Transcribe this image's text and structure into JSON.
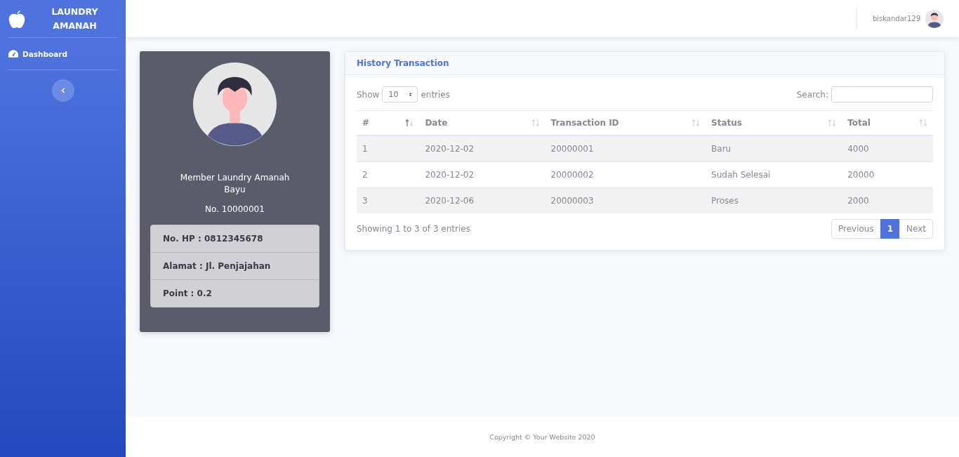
{
  "sidebar": {
    "brand": "LAUNDRY AMANAH",
    "items": [
      {
        "label": "Dashboard",
        "selected": true
      }
    ]
  },
  "topbar": {
    "username": "biskandar129"
  },
  "profile": {
    "title": "Member Laundry Amanah",
    "name": "Bayu",
    "number": "No. 10000001",
    "details": [
      "No. HP : 0812345678",
      "Alamat : Jl. Penjajahan",
      "Point : 0.2"
    ]
  },
  "history": {
    "title": "History Transaction",
    "show_label": "Show",
    "page_size": "10",
    "entries_label": "entries",
    "search_label": "Search:",
    "columns": [
      {
        "label": "#",
        "sorted": true
      },
      {
        "label": "Date",
        "sorted": false
      },
      {
        "label": "Transaction ID",
        "sorted": false
      },
      {
        "label": "Status",
        "sorted": false
      },
      {
        "label": "Total",
        "sorted": false
      }
    ],
    "rows": [
      [
        "1",
        "2020-12-02",
        "20000001",
        "Baru",
        "4000"
      ],
      [
        "2",
        "2020-12-02",
        "20000002",
        "Sudah Selesai",
        "20000"
      ],
      [
        "3",
        "2020-12-06",
        "20000003",
        "Proses",
        "2000"
      ]
    ],
    "info": "Showing 1 to 3 of 3 entries",
    "pagination": [
      {
        "label": "Previous",
        "selected": false
      },
      {
        "label": "1",
        "selected": true
      },
      {
        "label": "Next",
        "selected": false
      }
    ]
  },
  "footer": "Copyright © Your Website 2020"
}
